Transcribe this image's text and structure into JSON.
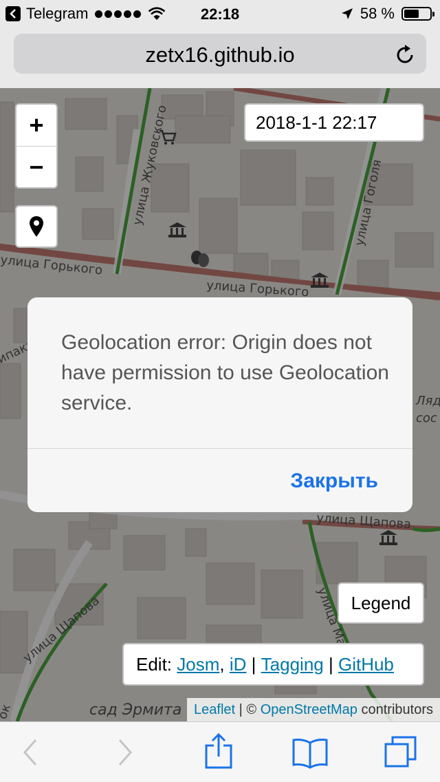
{
  "status_bar": {
    "back_app": "Telegram",
    "time": "22:18",
    "battery_percent": "58 %",
    "battery_level": 0.58,
    "icons": [
      "back-arrow-icon",
      "signal-dots-icon",
      "wifi-icon",
      "location-arrow-icon",
      "battery-icon"
    ]
  },
  "browser": {
    "url": "zetx16.github.io",
    "reload_icon": "reload-icon"
  },
  "map": {
    "zoom_in_label": "+",
    "zoom_out_label": "−",
    "locate_icon": "map-pin-icon",
    "date_label": "2018-1-1 22:17",
    "legend_label": "Legend",
    "edit": {
      "prefix": "Edit:",
      "links": [
        "Josm",
        "iD",
        "Tagging",
        "GitHub"
      ],
      "sep1": ",",
      "sep2": "|",
      "sep3": "|"
    },
    "attribution": {
      "leaflet": "Leaflet",
      "sep": "| ©",
      "osm": "OpenStreetMap",
      "suffix": "contributors"
    },
    "street_labels": [
      "улица Горького",
      "улица Горького",
      "улица Жуковского",
      "улица Гоголя",
      "улица Щапова",
      "улица Щапова",
      "улица Ма",
      "сад Эрмита",
      "ок",
      "Ляд",
      "сос",
      "ипакти"
    ],
    "colors": {
      "road_red": "#c47a72",
      "road_green": "#4ba83f",
      "building": "#d6d1cb"
    }
  },
  "dialog": {
    "message": "Geolocation error: Origin does not have permission to use Geolocation service.",
    "close_button": "Закрыть"
  },
  "toolbar": {
    "icons": [
      "back-chevron-icon",
      "forward-chevron-icon",
      "share-icon",
      "bookmarks-icon",
      "tabs-icon"
    ]
  }
}
